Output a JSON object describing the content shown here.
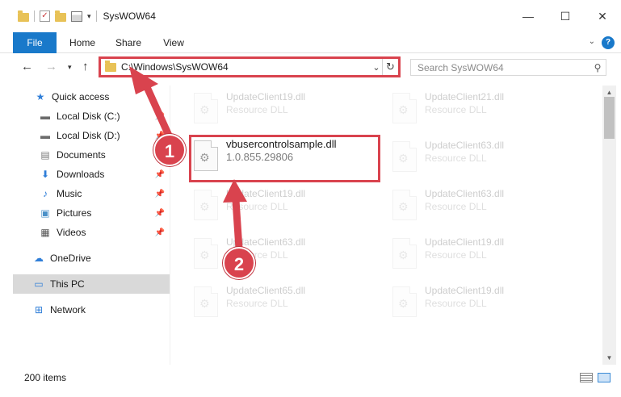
{
  "window": {
    "title": "SysWOW64",
    "minimize": "—",
    "maximize": "☐",
    "close": "✕"
  },
  "ribbon": {
    "tabs": [
      "File",
      "Home",
      "Share",
      "View"
    ],
    "help": "?"
  },
  "navigation": {
    "address": "C:\\Windows\\SysWOW64",
    "search_placeholder": "Search SysWOW64"
  },
  "sidebar": {
    "items": [
      {
        "label": "Quick access",
        "icon": "star-icon"
      },
      {
        "label": "Local Disk (C:)",
        "icon": "drive-icon",
        "pinned": true
      },
      {
        "label": "Local Disk (D:)",
        "icon": "drive-icon",
        "pinned": true
      },
      {
        "label": "Documents",
        "icon": "documents-icon",
        "pinned": true
      },
      {
        "label": "Downloads",
        "icon": "download-icon",
        "pinned": true
      },
      {
        "label": "Music",
        "icon": "music-icon",
        "pinned": true
      },
      {
        "label": "Pictures",
        "icon": "pictures-icon",
        "pinned": true
      },
      {
        "label": "Videos",
        "icon": "videos-icon",
        "pinned": true
      },
      {
        "label": "OneDrive",
        "icon": "cloud-icon"
      },
      {
        "label": "This PC",
        "icon": "computer-icon",
        "selected": true
      },
      {
        "label": "Network",
        "icon": "network-icon"
      }
    ]
  },
  "files": [
    {
      "name": "UpdateClient19.dll",
      "type": "Resource DLL"
    },
    {
      "name": "UpdateClient21.dll",
      "type": "Resource DLL"
    },
    {
      "name": "vbusercontrolsample.dll",
      "type": "1.0.855.29806",
      "highlighted": true
    },
    {
      "name": "UpdateClient63.dll",
      "type": "Resource DLL"
    },
    {
      "name": "UpdateClient19.dll",
      "type": "Resource DLL"
    },
    {
      "name": "UpdateClient63.dll",
      "type": "Resource DLL"
    },
    {
      "name": "UpdateClient63.dll",
      "type": "Resource DLL"
    },
    {
      "name": "UpdateClient19.dll",
      "type": "Resource DLL"
    },
    {
      "name": "UpdateClient65.dll",
      "type": "Resource DLL"
    },
    {
      "name": "UpdateClient19.dll",
      "type": "Resource DLL"
    }
  ],
  "status": {
    "item_count": "200 items"
  },
  "annotations": {
    "step1": "1",
    "step2": "2",
    "color": "#d9434e"
  }
}
